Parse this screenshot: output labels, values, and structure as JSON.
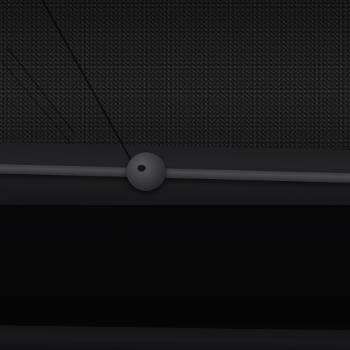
{
  "scene": {
    "ceiling_texture_color": "#1b1b1c",
    "rail_color": "#444446",
    "wall_color": "#070708",
    "knob_color": "#3c3c3e"
  }
}
